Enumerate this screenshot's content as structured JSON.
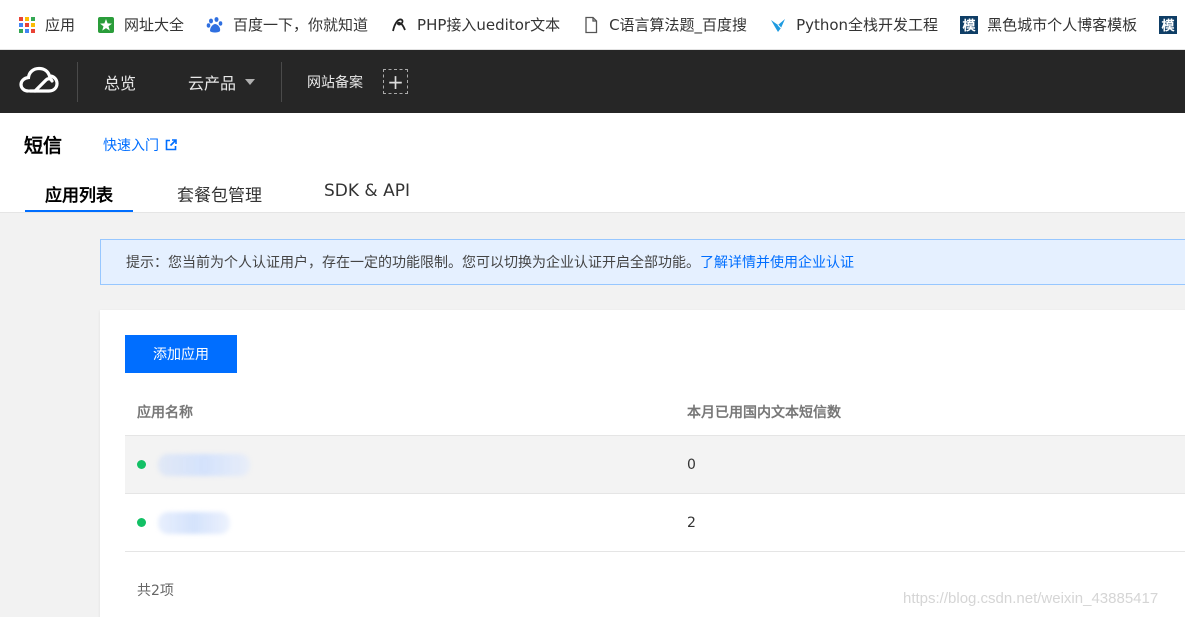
{
  "bookmarks": [
    {
      "label": "应用",
      "icon": "apps-grid-icon"
    },
    {
      "label": "网址大全",
      "icon": "hao123-icon"
    },
    {
      "label": "百度一下，你就知道",
      "icon": "baidu-paw-icon"
    },
    {
      "label": "PHP接入ueditor文本",
      "icon": "swirl-logo-icon"
    },
    {
      "label": "C语言算法题_百度搜",
      "icon": "document-icon"
    },
    {
      "label": "Python全栈开发工程",
      "icon": "bird-logo-icon"
    },
    {
      "label": "黑色城市个人博客模板",
      "icon": "mo-icon",
      "icon_text": "模"
    },
    {
      "label": "",
      "icon": "mo-icon",
      "icon_text": "模"
    }
  ],
  "topnav": {
    "overview": "总览",
    "products": "云产品",
    "beian": "网站备案",
    "add": "+"
  },
  "page": {
    "title": "短信",
    "quick_start": "快速入门"
  },
  "tabs": [
    "应用列表",
    "套餐包管理",
    "SDK & API"
  ],
  "alert": {
    "text": "提示：您当前为个人认证用户，存在一定的功能限制。您可以切换为企业认证开启全部功能。",
    "link": "了解详情并使用企业认证"
  },
  "card": {
    "add_button": "添加应用",
    "columns": [
      "应用名称",
      "本月已用国内文本短信数"
    ],
    "rows": [
      {
        "name": "",
        "status": "active",
        "count": "0"
      },
      {
        "name": "",
        "status": "active",
        "count": "2"
      }
    ],
    "total": "共2项"
  },
  "watermark": "https://blog.csdn.net/weixin_43885417",
  "colors": {
    "accent": "#006eff",
    "nav_bg": "#262626",
    "status_active": "#12c065",
    "alert_bg": "#e5f0ff"
  }
}
